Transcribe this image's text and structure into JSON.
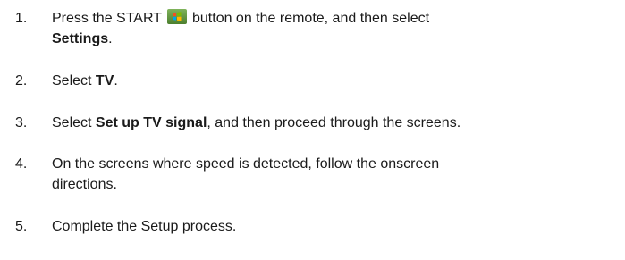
{
  "steps": [
    {
      "num": "1.",
      "pre": "Press the START",
      "post": "button on the remote, and then select",
      "bold": "Settings",
      "end": "."
    },
    {
      "num": "2.",
      "pre": "Select ",
      "bold": "TV",
      "end": "."
    },
    {
      "num": "3.",
      "pre": "Select ",
      "bold": "Set up TV signal",
      "end": ", and then proceed through the screens."
    },
    {
      "num": "4.",
      "line1": "On the screens where speed is detected, follow the onscreen",
      "line2": "directions."
    },
    {
      "num": "5.",
      "text": "Complete the Setup process."
    }
  ],
  "icons": {
    "start": "windows-start-icon"
  }
}
